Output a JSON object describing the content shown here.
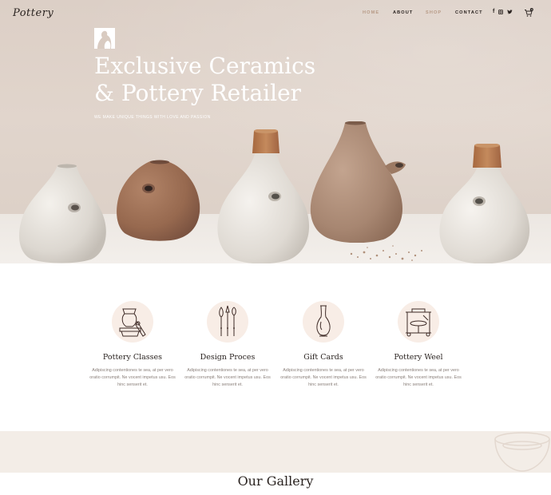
{
  "header": {
    "logo": "Pottery",
    "nav": [
      {
        "label": "HOME"
      },
      {
        "label": "ABOUT"
      },
      {
        "label": "SHOP"
      },
      {
        "label": "CONTACT"
      }
    ],
    "social_icons": [
      "facebook-icon",
      "instagram-icon",
      "twitter-icon"
    ],
    "cart_count": "0"
  },
  "hero": {
    "title_line1": "Exclusive Ceramics",
    "title_line2": "& Pottery Retailer",
    "subtitle": "WE MAKE UNIQUE THINGS WITH LOVE AND PASSION"
  },
  "services": [
    {
      "icon": "pottery-wheel-hand-icon",
      "title": "Pottery Classes",
      "text": "Adipiscing contentiones te sea, at per vero oratio corrumpit. Ne vocent impetus usu. Eos hinc senserit et."
    },
    {
      "icon": "sculpting-tools-icon",
      "title": "Design Proces",
      "text": "Adipiscing contentiones te sea, at per vero oratio corrumpit. Ne vocent impetus usu. Eos hinc senserit et."
    },
    {
      "icon": "vase-icon",
      "title": "Gift Cards",
      "text": "Adipiscing contentiones te sea, at per vero oratio corrumpit. Ne vocent impetus usu. Eos hinc senserit et."
    },
    {
      "icon": "pottery-wheel-icon",
      "title": "Pottery Weel",
      "text": "Adipiscing contentiones te sea, at per vero oratio corrumpit. Ne vocent impetus usu. Eos hinc senserit et."
    }
  ],
  "gallery": {
    "title": "Our Gallery"
  },
  "colors": {
    "accent": "#b79a86",
    "icon_bg": "#f8ede6",
    "band_bg": "#f3ede7",
    "text_dark": "#2a2320"
  }
}
